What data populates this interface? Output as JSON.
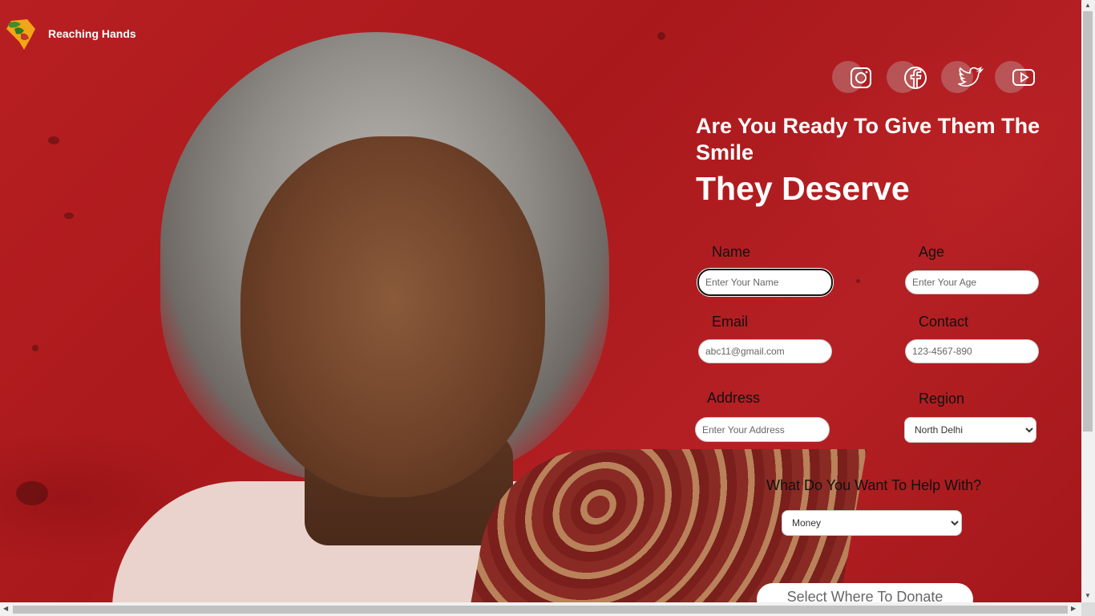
{
  "brand": {
    "name": "Reaching Hands"
  },
  "socials": [
    {
      "icon": "instagram-icon"
    },
    {
      "icon": "facebook-icon"
    },
    {
      "icon": "twitter-icon"
    },
    {
      "icon": "youtube-icon"
    }
  ],
  "headline": {
    "line1": "Are You Ready To Give Them The Smile",
    "line2": "They Deserve"
  },
  "form": {
    "name_label": "Name",
    "name_placeholder": "Enter Your Name",
    "age_label": "Age",
    "age_placeholder": "Enter Your Age",
    "email_label": "Email",
    "email_placeholder": "abc11@gmail.com",
    "contact_label": "Contact",
    "contact_placeholder": "123-4567-890",
    "address_label": "Address",
    "address_placeholder": "Enter Your Address",
    "region_label": "Region",
    "region_selected": "North Delhi",
    "help_label": "What Do You Want To Help With?",
    "help_selected": "Money",
    "donate_button": "Select Where To Donate"
  },
  "colors": {
    "background": "#b81f22",
    "text": "#ffffff"
  }
}
